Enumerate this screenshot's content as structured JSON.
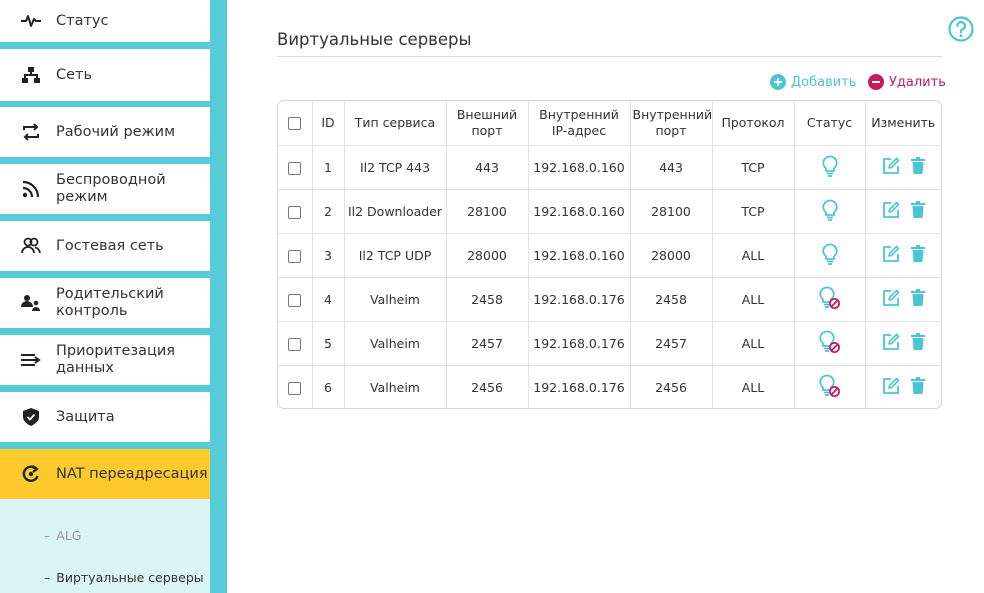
{
  "sidebar": {
    "items": [
      {
        "label": "Статус",
        "icon": "pulse-icon"
      },
      {
        "label": "Сеть",
        "icon": "network-icon"
      },
      {
        "label": "Рабочий режим",
        "icon": "mode-switch-icon"
      },
      {
        "label": "Беспроводной режим",
        "icon": "wifi-icon"
      },
      {
        "label": "Гостевая сеть",
        "icon": "guests-icon"
      },
      {
        "label": "Родительский контроль",
        "icon": "parental-icon"
      },
      {
        "label": "Приоритезация данных",
        "icon": "priority-icon"
      },
      {
        "label": "Защита",
        "icon": "shield-icon"
      },
      {
        "label": "NAT переадресация",
        "icon": "nat-icon",
        "active": true
      }
    ],
    "submenu": [
      {
        "label": "ALG"
      },
      {
        "label": "Виртуальные серверы",
        "active": true
      }
    ]
  },
  "main": {
    "title": "Виртуальные серверы",
    "add_label": "Добавить",
    "delete_label": "Удалить",
    "table": {
      "headers": [
        "ID",
        "Тип сервиса",
        "Внешний порт",
        "Внутренний IP-адрес",
        "Внутренний порт",
        "Протокол",
        "Статус",
        "Изменить"
      ],
      "rows": [
        {
          "id": "1",
          "service": "Il2 TCP 443",
          "ext_port": "443",
          "int_ip": "192.168.0.160",
          "int_port": "443",
          "protocol": "TCP",
          "enabled": true
        },
        {
          "id": "2",
          "service": "Il2 Downloader",
          "ext_port": "28100",
          "int_ip": "192.168.0.160",
          "int_port": "28100",
          "protocol": "TCP",
          "enabled": true
        },
        {
          "id": "3",
          "service": "Il2 TCP UDP",
          "ext_port": "28000",
          "int_ip": "192.168.0.160",
          "int_port": "28000",
          "protocol": "ALL",
          "enabled": true
        },
        {
          "id": "4",
          "service": "Valheim",
          "ext_port": "2458",
          "int_ip": "192.168.0.176",
          "int_port": "2458",
          "protocol": "ALL",
          "enabled": false
        },
        {
          "id": "5",
          "service": "Valheim",
          "ext_port": "2457",
          "int_ip": "192.168.0.176",
          "int_port": "2457",
          "protocol": "ALL",
          "enabled": false
        },
        {
          "id": "6",
          "service": "Valheim",
          "ext_port": "2456",
          "int_ip": "192.168.0.176",
          "int_port": "2456",
          "protocol": "ALL",
          "enabled": false
        }
      ]
    }
  },
  "colors": {
    "accent": "#4cc5d2",
    "sidebar_bg": "#55ccd8",
    "active_item": "#ffca2c",
    "delete": "#c51d5c",
    "disabled_mark": "#c51d5c"
  }
}
